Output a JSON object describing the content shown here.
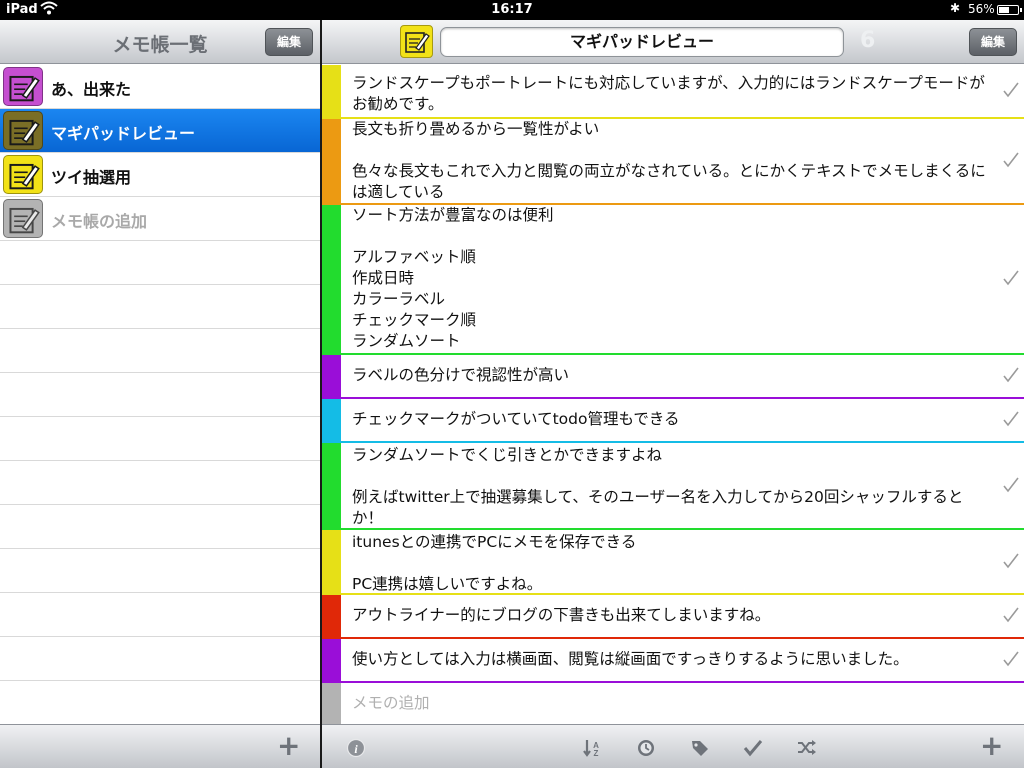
{
  "status": {
    "carrier": "iPad",
    "time": "16:17",
    "battery_text": "56%",
    "battery_level": 0.56
  },
  "left": {
    "title": "メモ帳一覧",
    "edit_label": "編集",
    "notebooks": [
      {
        "label": "あ、出来た",
        "color": "#c54fd0"
      },
      {
        "label": "マギパッドレビュー",
        "color": "#7a6e26"
      },
      {
        "label": "ツイ抽選用",
        "color": "#f2e217"
      }
    ],
    "add_label": "メモ帳の追加",
    "add_color": "#b3b3b3",
    "plus_icon": "plus-icon"
  },
  "right": {
    "title": "マギパッドレビュー",
    "count": "6",
    "edit_label": "編集",
    "header_icon_color": "#f2e217",
    "memos": [
      {
        "text": "ランドスケープもポートレートにも対応していますが、入力的にはランドスケープモードがお勧めです。",
        "color": "#e6e017",
        "checked": true
      },
      {
        "text": "長文も折り畳めるから一覧性がよい\n\n色々な長文もこれで入力と閲覧の両立がなされている。とにかくテキストでメモしまくるには適している",
        "color": "#ec9a12",
        "checked": true
      },
      {
        "text": "ソート方法が豊富なのは便利\n\nアルファベット順\n作成日時\nカラーラベル\nチェックマーク順\nランダムソート",
        "color": "#22dc2e",
        "checked": true
      },
      {
        "text": "ラベルの色分けで視認性が高い",
        "color": "#9a0ed8",
        "checked": true
      },
      {
        "text": "チェックマークがついていてtodo管理もできる",
        "color": "#14bce6",
        "checked": true
      },
      {
        "text": "ランダムソートでくじ引きとかできますよね\n\n例えばtwitter上で抽選募集して、そのユーザー名を入力してから20回シャッフルするとか！",
        "color": "#22dc2e",
        "checked": true
      },
      {
        "text": "itunesとの連携でPCにメモを保存できる\n\nPC連携は嬉しいですよね。",
        "color": "#e6e017",
        "checked": true
      },
      {
        "text": "アウトライナー的にブログの下書きも出来てしまいますね。",
        "color": "#e02808",
        "checked": true
      },
      {
        "text": "使い方としては入力は横画面、閲覧は縦画面ですっきりするように思いました。",
        "color": "#9a0ed8",
        "checked": true
      }
    ],
    "add_memo_label": "メモの追加",
    "add_memo_color": "#b3b3b3",
    "toolbar_icons": [
      "info-icon",
      "sort-alpha-icon",
      "clock-icon",
      "tag-icon",
      "checkmark-icon",
      "shuffle-icon",
      "plus-icon"
    ]
  }
}
